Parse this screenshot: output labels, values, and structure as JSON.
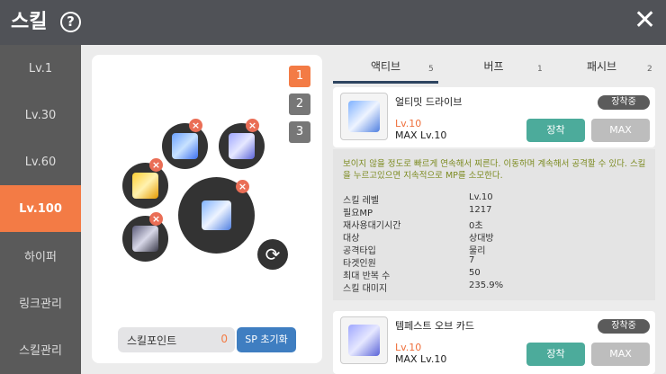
{
  "header": {
    "title": "스킬",
    "help_icon": "?",
    "close_icon": "✕"
  },
  "sidebar": {
    "items": [
      {
        "label": "Lv.1",
        "active": false
      },
      {
        "label": "Lv.30",
        "active": false
      },
      {
        "label": "Lv.60",
        "active": false
      },
      {
        "label": "Lv.100",
        "active": true
      },
      {
        "label": "하이퍼",
        "active": false
      },
      {
        "label": "링크관리",
        "active": false
      },
      {
        "label": "스킬관리",
        "active": false
      }
    ]
  },
  "presets": [
    "1",
    "2",
    "3"
  ],
  "skill_points": {
    "label": "스킬포인트",
    "value": "0",
    "reset_label": "SP 초기화"
  },
  "tabs": [
    {
      "label": "액티브",
      "count": "5"
    },
    {
      "label": "버프",
      "count": "1"
    },
    {
      "label": "패시브",
      "count": "2"
    }
  ],
  "skills": [
    {
      "name": "얼티밋 드라이브",
      "level": "Lv.10",
      "max": "MAX Lv.10",
      "badge": "장착중",
      "equip_label": "장착",
      "max_label": "MAX",
      "description": "보이지 않을 정도로 빠르게 연속해서 찌른다. 이동하며 계속해서 공격할 수 있다. 스킬을 누르고있으면 지속적으로 MP를 소모한다.",
      "stats": [
        {
          "k": "스킬 레벨",
          "v": "Lv.10"
        },
        {
          "k": "필요MP",
          "v": "1217"
        },
        {
          "k": "재사용대기시간",
          "v": "0초"
        },
        {
          "k": "대상",
          "v": "상대방"
        },
        {
          "k": "공격타입",
          "v": "물리"
        },
        {
          "k": "타겟인원",
          "v": "7"
        },
        {
          "k": "최대 반복 수",
          "v": "50"
        },
        {
          "k": "스킬 대미지",
          "v": "235.9%"
        }
      ]
    },
    {
      "name": "템페스트 오브 카드",
      "level": "Lv.10",
      "max": "MAX Lv.10",
      "badge": "장착중",
      "equip_label": "장착",
      "max_label": "MAX"
    }
  ],
  "colors": {
    "accent": "#f37b45",
    "equip": "#4cab9b",
    "reset": "#3f7ec1",
    "description": "#7b8a1f"
  }
}
